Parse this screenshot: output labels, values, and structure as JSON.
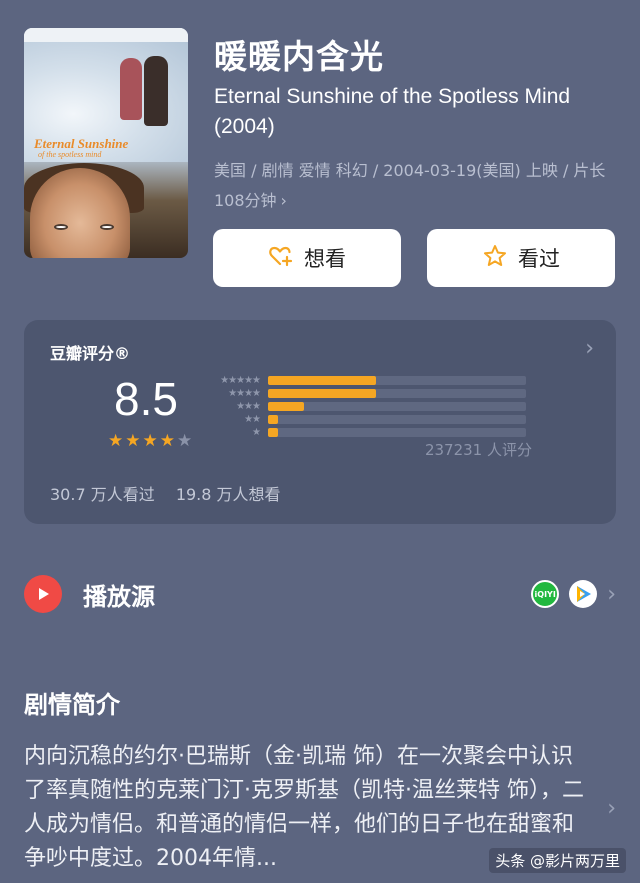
{
  "movie": {
    "title_cn": "暖暖内含光",
    "title_en": "Eternal Sunshine of the Spotless Mind (2004)",
    "meta_line": "美国 / 剧情 爱情 科幻 / 2004-03-19(美国) 上映 / 片长108分钟",
    "meta_chevron": "›",
    "poster": {
      "title_line1": "Eternal Sunshine",
      "title_line2": "of the spotless mind"
    }
  },
  "actions": {
    "want_label": "想看",
    "seen_label": "看过"
  },
  "rating": {
    "header": "豆瓣评分®",
    "score": "8.5",
    "stars_filled": 4,
    "stars_total": 5,
    "distribution": [
      {
        "stars": "★★★★★",
        "fraction": 0.42
      },
      {
        "stars": "★★★★",
        "fraction": 0.42
      },
      {
        "stars": "★★★",
        "fraction": 0.14
      },
      {
        "stars": "★★",
        "fraction": 0.04
      },
      {
        "stars": "★",
        "fraction": 0.04
      }
    ],
    "count_text": "237231 人评分",
    "watched_text": "30.7 万人看过",
    "wish_text": "19.8 万人想看",
    "accent": "#f5a623"
  },
  "play": {
    "label": "播放源",
    "sources": [
      "iqiyi-icon",
      "tencent-video-icon"
    ],
    "iqiyi_text": "iQIYI"
  },
  "intro": {
    "title": "剧情简介",
    "text": "内向沉稳的约尔·巴瑞斯（金·凯瑞 饰）在一次聚会中认识了率真随性的克莱门汀·克罗斯基（凯特·温丝莱特 饰），二人成为情侣。和普通的情侣一样，他们的日子也在甜蜜和争吵中度过。2004年情..."
  },
  "watermark": "头条 @影片两万里"
}
